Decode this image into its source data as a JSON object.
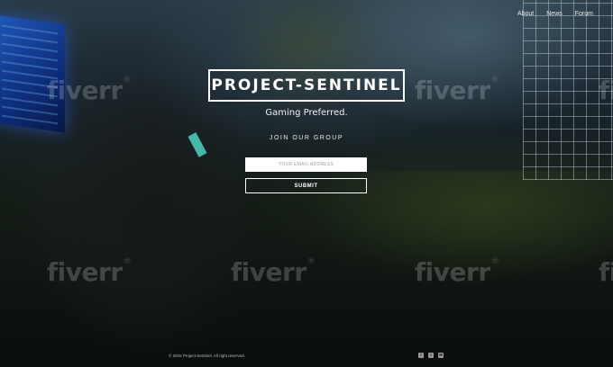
{
  "nav": {
    "items": [
      "About",
      "News",
      "Forum"
    ]
  },
  "hero": {
    "logo_text": "PROJECT-SENTINEL",
    "tagline": "Gaming Preferred.",
    "join_heading": "JOIN OUR GROUP"
  },
  "form": {
    "email_placeholder": "YOUR EMAIL ADDRESS",
    "submit_label": "SUBMIT"
  },
  "footer": {
    "copyright": "© 2015 Project-Sentinel. All right reserved.",
    "social_icons": [
      "facebook-icon",
      "twitter-icon",
      "email-icon"
    ],
    "social_glyphs": [
      "f",
      "t",
      "✉"
    ]
  },
  "watermark": {
    "text": "fiverr",
    "mark": "®"
  },
  "colors": {
    "background": "#0c1012",
    "text": "#ffffff",
    "input_bg": "#ffffff"
  }
}
